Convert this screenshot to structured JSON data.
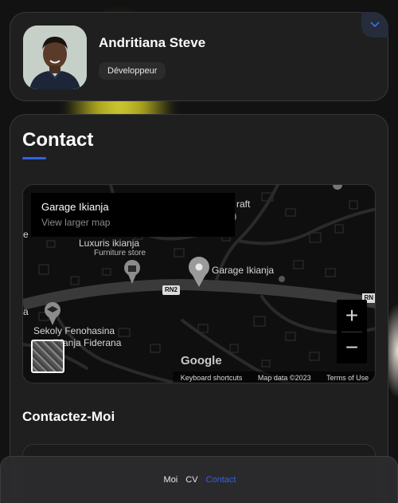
{
  "profile": {
    "name": "Andritiana Steve",
    "role": "Développeur"
  },
  "contact": {
    "title": "Contact",
    "subtitle": "Contactez-Moi"
  },
  "map": {
    "place_name": "Garage Ikianja",
    "view_larger": "View larger map",
    "labels": {
      "craft": "raft",
      "luxuris": "Luxuris ikianja",
      "furniture": "Furniture store",
      "garage_pin": "Garage Ikianja",
      "road": "RN2",
      "road_right": "RN",
      "sekoly": "Sekoly Fenohasina",
      "fiderana": "Ikianja Fiderana",
      "edge_e": "e",
      "edge_a": "a"
    },
    "zoom_in": "+",
    "zoom_out": "−",
    "google": "Google",
    "footer": {
      "shortcuts": "Keyboard shortcuts",
      "mapdata": "Map data ©2023",
      "terms": "Terms of Use"
    }
  },
  "nav": {
    "items": [
      "Moi",
      "CV",
      "Contact"
    ],
    "active": "Contact"
  },
  "colors": {
    "accent": "#2f63e0",
    "card_bg": "#1f1f20",
    "page_bg": "#121212"
  },
  "icons": {
    "toggle": "chevron-down-icon",
    "shop": "shopping-bag-pin-icon",
    "school": "graduation-cap-pin-icon",
    "place": "map-pin-icon"
  }
}
